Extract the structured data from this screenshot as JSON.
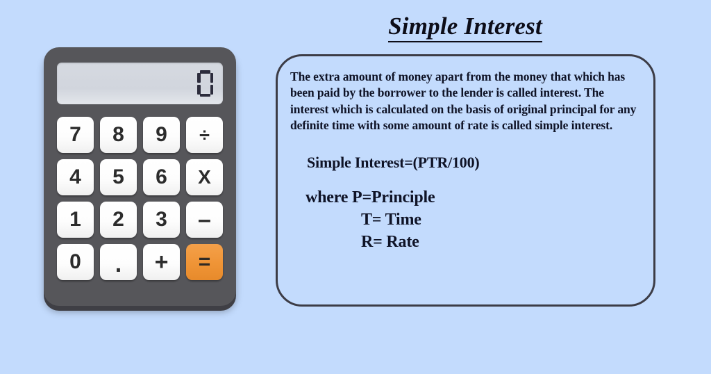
{
  "background_color": "#c3dbfd",
  "calculator": {
    "body_color": "#56565a",
    "accent_color": "#ef9436",
    "display": {
      "value": "0",
      "background_color": "#d3d7df",
      "digit_color": "#2c2c3c"
    },
    "keys": [
      {
        "label": "7",
        "name": "key-7",
        "accent": false
      },
      {
        "label": "8",
        "name": "key-8",
        "accent": false
      },
      {
        "label": "9",
        "name": "key-9",
        "accent": false
      },
      {
        "label": "÷",
        "name": "key-divide",
        "accent": false
      },
      {
        "label": "4",
        "name": "key-4",
        "accent": false
      },
      {
        "label": "5",
        "name": "key-5",
        "accent": false
      },
      {
        "label": "6",
        "name": "key-6",
        "accent": false
      },
      {
        "label": "X",
        "name": "key-multiply",
        "accent": false
      },
      {
        "label": "1",
        "name": "key-1",
        "accent": false
      },
      {
        "label": "2",
        "name": "key-2",
        "accent": false
      },
      {
        "label": "3",
        "name": "key-3",
        "accent": false
      },
      {
        "label": "–",
        "name": "key-minus",
        "accent": false
      },
      {
        "label": "0",
        "name": "key-0",
        "accent": false
      },
      {
        "label": ".",
        "name": "key-decimal",
        "accent": false
      },
      {
        "label": "+",
        "name": "key-plus",
        "accent": false
      },
      {
        "label": "=",
        "name": "key-equals",
        "accent": true
      }
    ]
  },
  "panel": {
    "title": "Simple Interest",
    "paragraph": "The extra amount of money apart from the money that which has been paid by the borrower to the lender is called interest. The interest which is calculated on the  basis of original principal for any definite time  with some amount of rate is called simple interest.",
    "formula": "Simple Interest=(PTR/100)",
    "definitions": {
      "line1": "where P=Principle",
      "line2": "T= Time",
      "line3": "R= Rate"
    },
    "border_color": "#3c3c46",
    "text_color": "#0f1326"
  }
}
